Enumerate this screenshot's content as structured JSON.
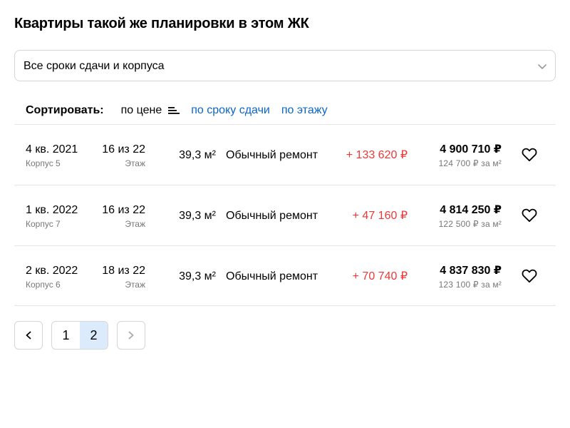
{
  "heading": "Квартиры такой же планировки в этом ЖК",
  "filter": {
    "selected": "Все сроки сдачи и корпуса",
    "icon": "chevron-down-icon"
  },
  "sort": {
    "label": "Сортировать:",
    "options": [
      {
        "label": "по цене",
        "active": true
      },
      {
        "label": "по сроку сдачи",
        "active": false
      },
      {
        "label": "по этажу",
        "active": false
      }
    ]
  },
  "colors": {
    "link": "#0a66c9",
    "price_increase": "#f03737",
    "page_active_bg": "#dcebfb",
    "muted_text": "#777777"
  },
  "flats": [
    {
      "date": "4 кв. 2021",
      "building": "Корпус 5",
      "floor": "16 из 22",
      "floor_label": "Этаж",
      "area": "39,3 м²",
      "finish": "Обычный ремонт",
      "price_diff": "+ 133 620 ₽",
      "price": "4 900 710 ₽",
      "price_per_m2": "124 700 ₽ за м²"
    },
    {
      "date": "1 кв. 2022",
      "building": "Корпус 7",
      "floor": "16 из 22",
      "floor_label": "Этаж",
      "area": "39,3 м²",
      "finish": "Обычный ремонт",
      "price_diff": "+ 47 160 ₽",
      "price": "4 814 250 ₽",
      "price_per_m2": "122 500 ₽ за м²"
    },
    {
      "date": "2 кв. 2022",
      "building": "Корпус 6",
      "floor": "18 из 22",
      "floor_label": "Этаж",
      "area": "39,3 м²",
      "finish": "Обычный ремонт",
      "price_diff": "+ 70 740 ₽",
      "price": "4 837 830 ₽",
      "price_per_m2": "123 100 ₽ за м²"
    }
  ],
  "pagination": {
    "pages": [
      "1",
      "2"
    ],
    "current": "2"
  }
}
